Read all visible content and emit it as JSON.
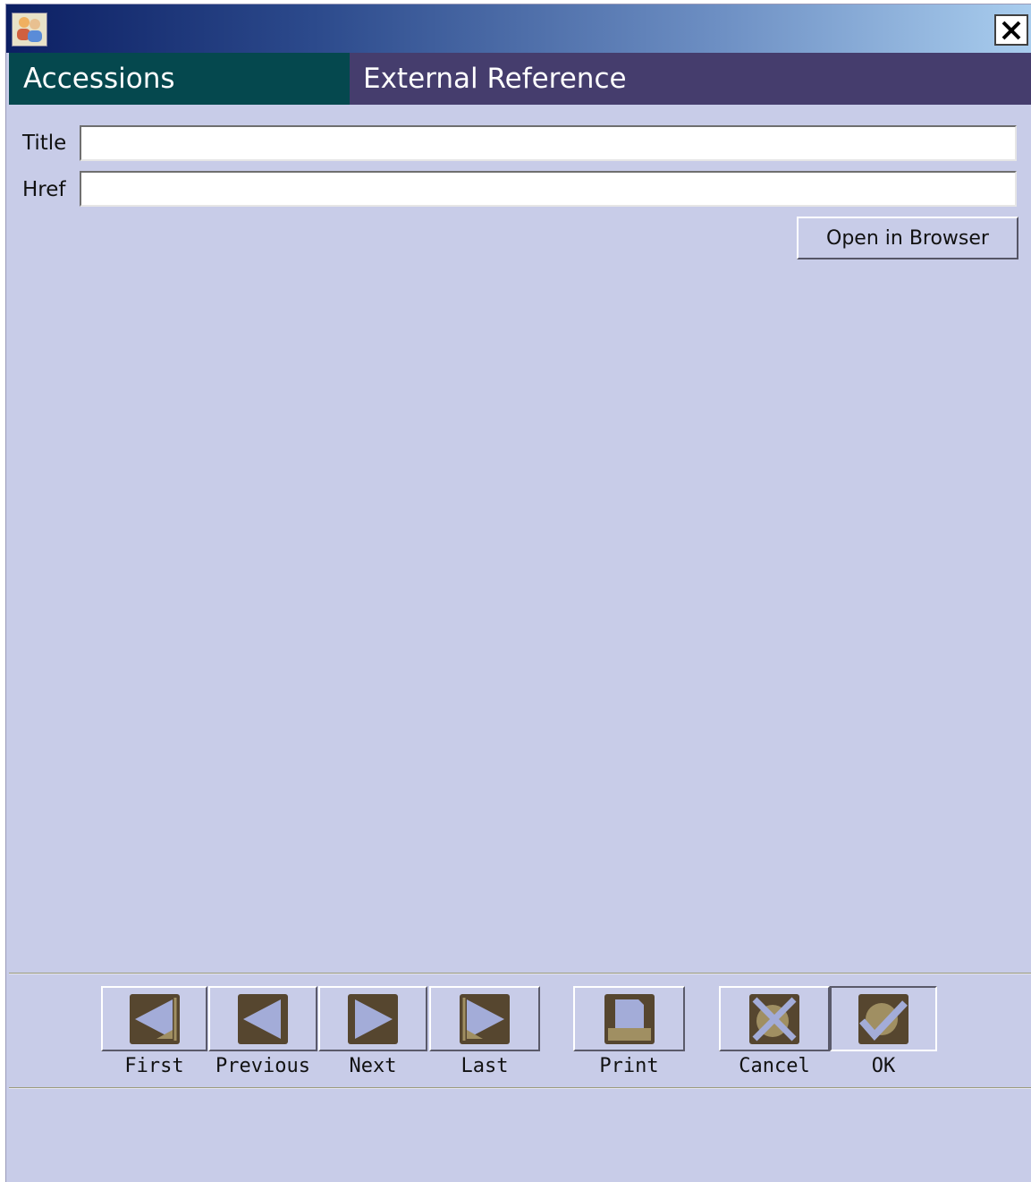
{
  "window": {
    "close_label": "×",
    "app_icon": "users-icon"
  },
  "header": {
    "module": "Accessions",
    "section": "External Reference"
  },
  "form": {
    "title_label": "Title",
    "title_value": "",
    "href_label": "Href",
    "href_value": "",
    "open_browser_label": "Open in Browser"
  },
  "toolbar": {
    "first": "First",
    "previous": "Previous",
    "next": "Next",
    "last": "Last",
    "print": "Print",
    "cancel": "Cancel",
    "ok": "OK"
  },
  "colors": {
    "body": "#c8cce8",
    "header_left": "#05484e",
    "header_right": "#453d6d",
    "icon_dark": "#56462f",
    "icon_light": "#a3acd8",
    "icon_tan": "#a08f62"
  }
}
